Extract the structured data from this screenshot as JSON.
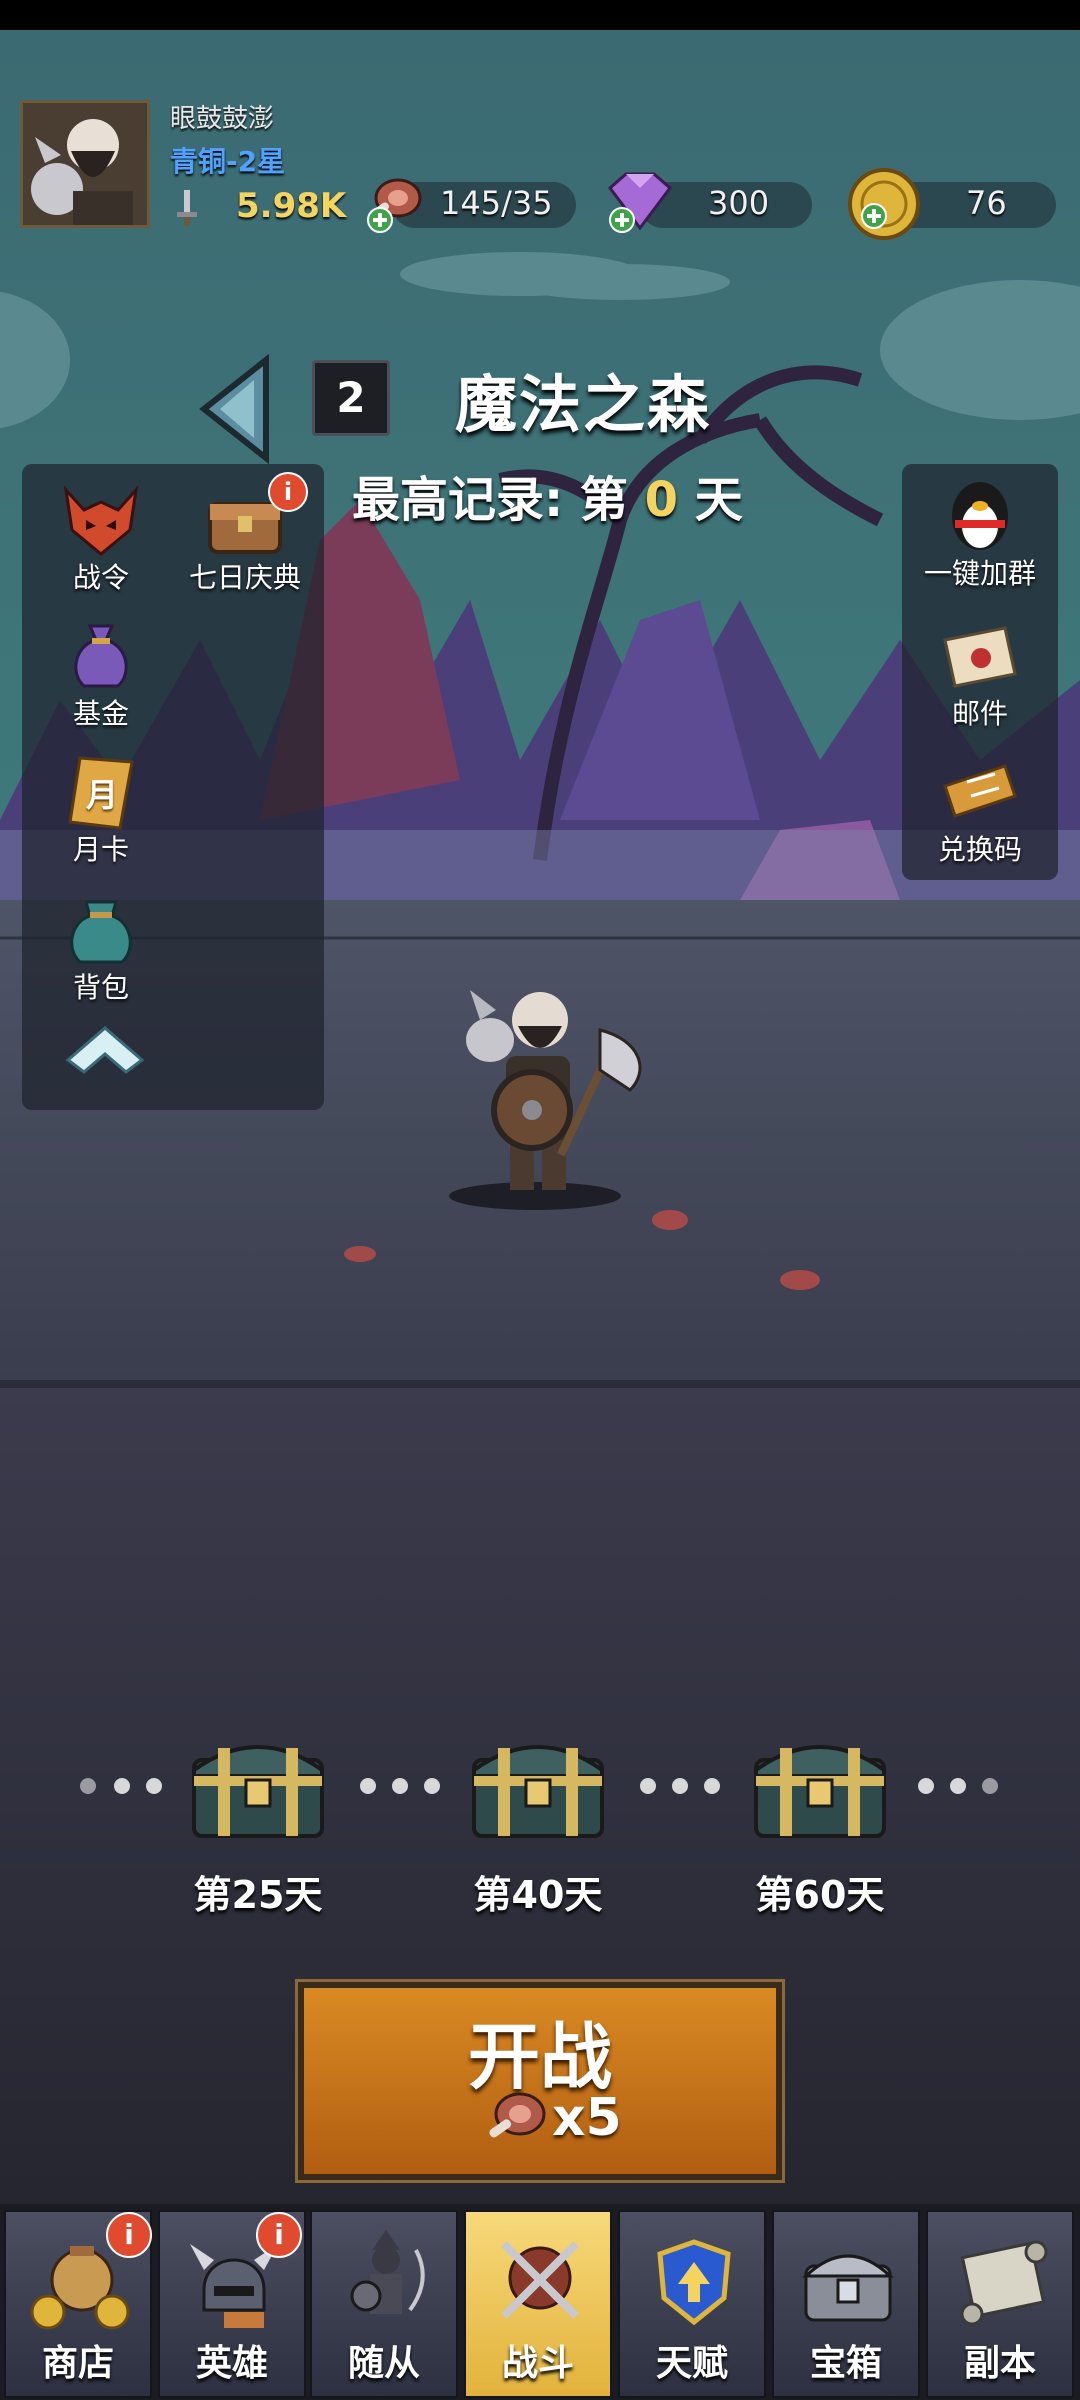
{
  "player": {
    "name": "眼鼓鼓澎",
    "rank": "青铜-2星",
    "power": "5.98K"
  },
  "resources": {
    "stamina": "145/35",
    "gems": "300",
    "coins": "76"
  },
  "stage": {
    "number": "2",
    "name": "魔法之森",
    "record_prefix": "最高记录: 第",
    "record_value": "0",
    "record_suffix": "天"
  },
  "left_menu": [
    {
      "label": "战令"
    },
    {
      "label": "七日庆典",
      "badge": "i"
    },
    {
      "label": "基金"
    },
    {
      "label": "月卡",
      "icon_text": "月"
    },
    {
      "label": "背包"
    }
  ],
  "right_menu": [
    {
      "label": "一键加群"
    },
    {
      "label": "邮件"
    },
    {
      "label": "兑换码"
    }
  ],
  "chests": [
    {
      "label": "第25天"
    },
    {
      "label": "第40天"
    },
    {
      "label": "第60天"
    }
  ],
  "fight_button": {
    "label": "开战",
    "cost": "x5"
  },
  "nav": {
    "tabs": [
      {
        "label": "商店",
        "badge": "i"
      },
      {
        "label": "英雄",
        "badge": "i"
      },
      {
        "label": "随从"
      },
      {
        "label": "战斗",
        "active": true
      },
      {
        "label": "天赋"
      },
      {
        "label": "宝箱"
      },
      {
        "label": "副本"
      }
    ]
  },
  "colors": {
    "accent_gold": "#f4d35e",
    "rank_blue": "#4fa3ff",
    "badge_red": "#e04a2f",
    "active_tab": "#f7d97a",
    "fight_orange": "#d98a22"
  }
}
